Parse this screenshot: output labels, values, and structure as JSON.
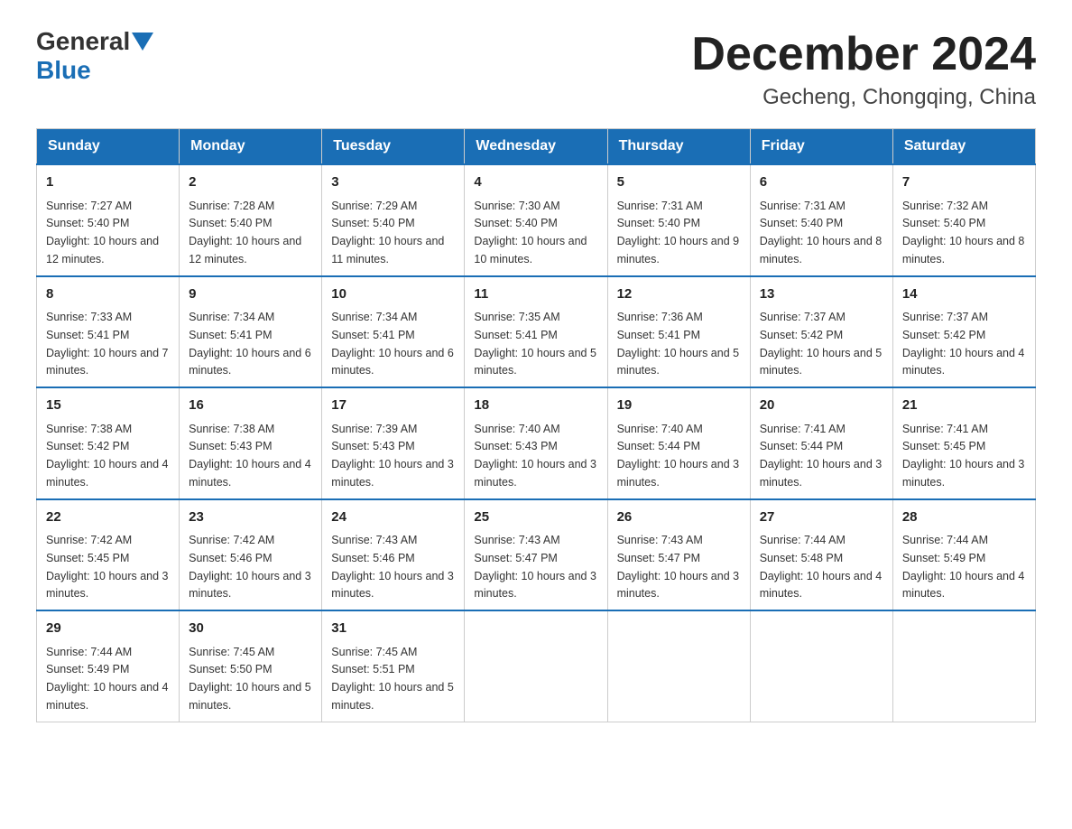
{
  "header": {
    "logo_general": "General",
    "logo_blue": "Blue",
    "main_title": "December 2024",
    "subtitle": "Gecheng, Chongqing, China"
  },
  "weekdays": [
    "Sunday",
    "Monday",
    "Tuesday",
    "Wednesday",
    "Thursday",
    "Friday",
    "Saturday"
  ],
  "weeks": [
    [
      {
        "day": "1",
        "sunrise": "7:27 AM",
        "sunset": "5:40 PM",
        "daylight": "10 hours and 12 minutes."
      },
      {
        "day": "2",
        "sunrise": "7:28 AM",
        "sunset": "5:40 PM",
        "daylight": "10 hours and 12 minutes."
      },
      {
        "day": "3",
        "sunrise": "7:29 AM",
        "sunset": "5:40 PM",
        "daylight": "10 hours and 11 minutes."
      },
      {
        "day": "4",
        "sunrise": "7:30 AM",
        "sunset": "5:40 PM",
        "daylight": "10 hours and 10 minutes."
      },
      {
        "day": "5",
        "sunrise": "7:31 AM",
        "sunset": "5:40 PM",
        "daylight": "10 hours and 9 minutes."
      },
      {
        "day": "6",
        "sunrise": "7:31 AM",
        "sunset": "5:40 PM",
        "daylight": "10 hours and 8 minutes."
      },
      {
        "day": "7",
        "sunrise": "7:32 AM",
        "sunset": "5:40 PM",
        "daylight": "10 hours and 8 minutes."
      }
    ],
    [
      {
        "day": "8",
        "sunrise": "7:33 AM",
        "sunset": "5:41 PM",
        "daylight": "10 hours and 7 minutes."
      },
      {
        "day": "9",
        "sunrise": "7:34 AM",
        "sunset": "5:41 PM",
        "daylight": "10 hours and 6 minutes."
      },
      {
        "day": "10",
        "sunrise": "7:34 AM",
        "sunset": "5:41 PM",
        "daylight": "10 hours and 6 minutes."
      },
      {
        "day": "11",
        "sunrise": "7:35 AM",
        "sunset": "5:41 PM",
        "daylight": "10 hours and 5 minutes."
      },
      {
        "day": "12",
        "sunrise": "7:36 AM",
        "sunset": "5:41 PM",
        "daylight": "10 hours and 5 minutes."
      },
      {
        "day": "13",
        "sunrise": "7:37 AM",
        "sunset": "5:42 PM",
        "daylight": "10 hours and 5 minutes."
      },
      {
        "day": "14",
        "sunrise": "7:37 AM",
        "sunset": "5:42 PM",
        "daylight": "10 hours and 4 minutes."
      }
    ],
    [
      {
        "day": "15",
        "sunrise": "7:38 AM",
        "sunset": "5:42 PM",
        "daylight": "10 hours and 4 minutes."
      },
      {
        "day": "16",
        "sunrise": "7:38 AM",
        "sunset": "5:43 PM",
        "daylight": "10 hours and 4 minutes."
      },
      {
        "day": "17",
        "sunrise": "7:39 AM",
        "sunset": "5:43 PM",
        "daylight": "10 hours and 3 minutes."
      },
      {
        "day": "18",
        "sunrise": "7:40 AM",
        "sunset": "5:43 PM",
        "daylight": "10 hours and 3 minutes."
      },
      {
        "day": "19",
        "sunrise": "7:40 AM",
        "sunset": "5:44 PM",
        "daylight": "10 hours and 3 minutes."
      },
      {
        "day": "20",
        "sunrise": "7:41 AM",
        "sunset": "5:44 PM",
        "daylight": "10 hours and 3 minutes."
      },
      {
        "day": "21",
        "sunrise": "7:41 AM",
        "sunset": "5:45 PM",
        "daylight": "10 hours and 3 minutes."
      }
    ],
    [
      {
        "day": "22",
        "sunrise": "7:42 AM",
        "sunset": "5:45 PM",
        "daylight": "10 hours and 3 minutes."
      },
      {
        "day": "23",
        "sunrise": "7:42 AM",
        "sunset": "5:46 PM",
        "daylight": "10 hours and 3 minutes."
      },
      {
        "day": "24",
        "sunrise": "7:43 AM",
        "sunset": "5:46 PM",
        "daylight": "10 hours and 3 minutes."
      },
      {
        "day": "25",
        "sunrise": "7:43 AM",
        "sunset": "5:47 PM",
        "daylight": "10 hours and 3 minutes."
      },
      {
        "day": "26",
        "sunrise": "7:43 AM",
        "sunset": "5:47 PM",
        "daylight": "10 hours and 3 minutes."
      },
      {
        "day": "27",
        "sunrise": "7:44 AM",
        "sunset": "5:48 PM",
        "daylight": "10 hours and 4 minutes."
      },
      {
        "day": "28",
        "sunrise": "7:44 AM",
        "sunset": "5:49 PM",
        "daylight": "10 hours and 4 minutes."
      }
    ],
    [
      {
        "day": "29",
        "sunrise": "7:44 AM",
        "sunset": "5:49 PM",
        "daylight": "10 hours and 4 minutes."
      },
      {
        "day": "30",
        "sunrise": "7:45 AM",
        "sunset": "5:50 PM",
        "daylight": "10 hours and 5 minutes."
      },
      {
        "day": "31",
        "sunrise": "7:45 AM",
        "sunset": "5:51 PM",
        "daylight": "10 hours and 5 minutes."
      },
      null,
      null,
      null,
      null
    ]
  ]
}
